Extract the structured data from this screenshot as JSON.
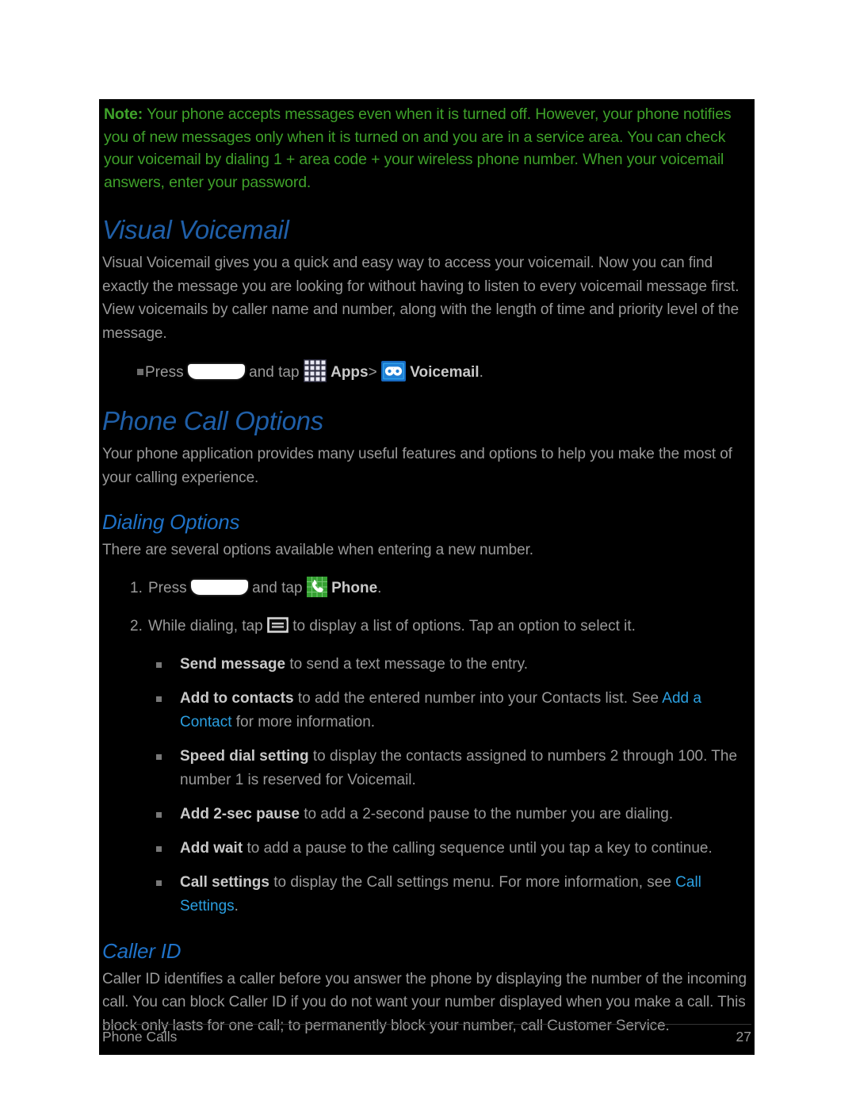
{
  "page": {
    "background": "#ffffff",
    "sheet_background": "#000000"
  },
  "colors": {
    "note_green": "#3fa22a",
    "heading_major_blue": "#1f5fa8",
    "heading_minor_blue": "#1f72c8",
    "body_gray": "#9a9a9a",
    "bold_gray": "#c9c9c9",
    "xref_blue": "#2b9fe0"
  },
  "note": {
    "label": "Note:",
    "text": " Your phone accepts messages even when it is turned off. However, your phone notifies you of new messages only when it is turned on and you are in a service area. You can check your voicemail by dialing 1 + area code + your wireless phone number. When your voicemail answers, enter your password."
  },
  "visual_voicemail": {
    "heading": "Visual Voicemail",
    "paragraph": "Visual Voicemail gives you a quick and easy way to access your voicemail. Now you can find exactly the message you are looking for without having to listen to every voicemail message first. View voicemails by caller name and number, along with the length of time and priority level of the message.",
    "bullet": {
      "press_label": "Press",
      "and_tap_label": "and tap",
      "apps_label": "Apps",
      "separator": ">",
      "voicemail_label": "Voicemail",
      "period": ".",
      "home_icon_name": "home-key-icon",
      "apps_icon_name": "apps-grid-icon",
      "voicemail_icon_name": "voicemail-icon"
    }
  },
  "phone_call_options": {
    "heading": "Phone Call Options",
    "paragraph": "Your phone application provides many useful features and options to help you make the most of your calling experience."
  },
  "dialing_options": {
    "heading": "Dialing Options",
    "paragraph": "There are several options available when entering a new number.",
    "steps": [
      {
        "number": "1.",
        "press_label": "Press",
        "and_tap_label": "and tap",
        "target_label": "Phone",
        "period": ".",
        "home_icon_name": "home-key-icon",
        "app_icon_name": "phone-icon"
      },
      {
        "number": "2.",
        "prefix": "While dialing, tap",
        "suffix": "to display a list of options. Tap an option to select it.",
        "menu_icon_name": "menu-key-icon"
      }
    ],
    "options": [
      {
        "term": "Send message",
        "text": " to send a text message to the entry.",
        "link": null,
        "tail": null
      },
      {
        "term": "Add to contacts",
        "text": " to add the entered number into your Contacts list. See ",
        "link": "Add a Contact",
        "tail": " for more information."
      },
      {
        "term": "Speed dial setting",
        "text": " to display the contacts assigned to numbers 2 through 100. The number 1 is reserved for Voicemail.",
        "link": null,
        "tail": null
      },
      {
        "term": "Add 2-sec pause",
        "text": " to add a 2-second pause to the number you are dialing.",
        "link": null,
        "tail": null
      },
      {
        "term": "Add wait",
        "text": " to add a pause to the calling sequence until you tap a key to continue.",
        "link": null,
        "tail": null
      },
      {
        "term": "Call settings",
        "text": " to display the Call settings menu. For more information, see ",
        "link": "Call Settings",
        "tail": "."
      }
    ]
  },
  "caller_id": {
    "heading": "Caller ID",
    "paragraph": "Caller ID identifies a caller before you answer the phone by displaying the number of the incoming call. You can block Caller ID if you do not want your number displayed when you make a call. This block only lasts for one call; to permanently block your number, call Customer Service."
  },
  "footer": {
    "section": "Phone Calls",
    "page_number": "27"
  }
}
